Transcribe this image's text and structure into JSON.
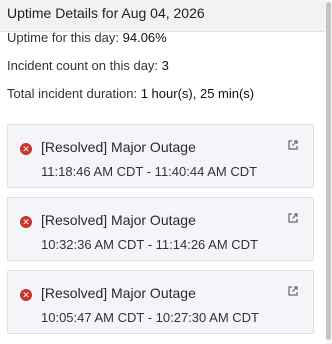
{
  "header": {
    "title": "Uptime Details for Aug 04, 2026"
  },
  "summary": {
    "uptime_label": "Uptime for this day:",
    "uptime_value": "94.06%",
    "incident_label": "Incident count on this day:",
    "incident_value": "3",
    "duration_label": "Total incident duration:",
    "duration_value": "1 hour(s), 25 min(s)"
  },
  "incidents": [
    {
      "title": "[Resolved] Major Outage",
      "time": "11:18:46 AM CDT - 11:40:44 AM CDT"
    },
    {
      "title": "[Resolved] Major Outage",
      "time": "10:32:36 AM CDT - 11:14:26 AM CDT"
    },
    {
      "title": "[Resolved] Major Outage",
      "time": "10:05:47 AM CDT - 10:27:30 AM CDT"
    }
  ],
  "icons": {
    "status": "error-icon",
    "link": "external-link-icon"
  },
  "colors": {
    "error": "#c9352c",
    "card_bg": "#f3f5f8",
    "header_bg": "#f2f2f2"
  }
}
